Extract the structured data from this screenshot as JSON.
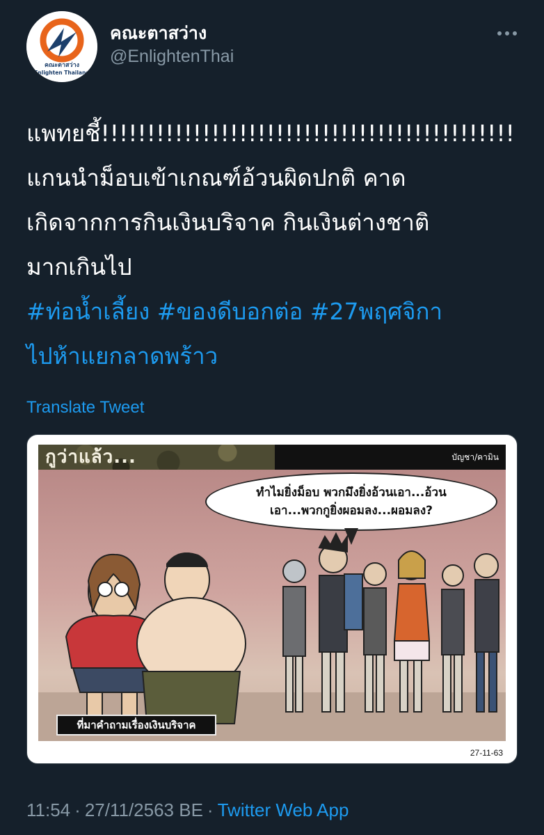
{
  "author": {
    "display_name": "คณะตาสว่าง",
    "handle": "@EnlightenThai",
    "avatar_text_th": "คณะตาสว่าง",
    "avatar_text_en": "Enlighten Thailand"
  },
  "tweet": {
    "line1": "แพทยชี้!!!!!!!!!!!!!!!!!!!!!!!!!!!!!!!!!!!!!!!!!!!!!!!!!!",
    "line2": "แกนนำม็อบเข้าเกณฑ์อ้วนผิดปกติ คาด",
    "line3": "เกิดจากการกินเงินบริจาค กินเงินต่างชาติ",
    "line4": "มากเกินไป",
    "hashtags": [
      "#ท่อน้ำเลี้ยง",
      "#ของดีบอกต่อ",
      "#27พฤศจิกา",
      "ไปห้าแยกลาดพร้าว"
    ]
  },
  "translate_label": "Translate Tweet",
  "media": {
    "comic_title": "กูว่าแล้ว...",
    "comic_author": "บัญชา/คามิน",
    "speech_line1": "ทำไมยิ่งม็อบ พวกมึงยิ่งอ้วนเอา...อ้วน",
    "speech_line2": "เอา...พวกกูยิ่งผอมลง...ผอมลง?",
    "caption": "ที่มาคำถามเรื่องเงินบริจาค",
    "date": "27-11-63"
  },
  "meta": {
    "time": "11:54",
    "date": "27/11/2563 BE",
    "separator": "·",
    "app": "Twitter Web App"
  },
  "colors": {
    "background": "#15202b",
    "link": "#1d9bf0",
    "muted": "#8899a6",
    "text": "#ffffff"
  }
}
